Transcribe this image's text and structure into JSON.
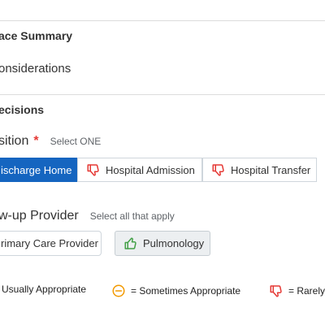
{
  "sections": {
    "summary_title": "ace Summary",
    "considerations_title": "onsiderations",
    "decisions_title": "ecisions"
  },
  "disposition": {
    "label": "sition",
    "required_marker": "*",
    "hint": "Select ONE",
    "options": [
      {
        "label": "ischarge Home",
        "state": "selected",
        "icon": "none"
      },
      {
        "label": "Hospital Admission",
        "state": "unselected",
        "icon": "thumbs-down-icon"
      },
      {
        "label": "Hospital Transfer",
        "state": "unselected",
        "icon": "thumbs-down-icon"
      }
    ]
  },
  "followup": {
    "label": "w-up Provider",
    "hint": "Select all that apply",
    "options": [
      {
        "label": "rimary Care Provider",
        "state": "unselected",
        "icon": "none"
      },
      {
        "label": "Pulmonology",
        "state": "toggled",
        "icon": "thumbs-up-icon"
      }
    ]
  },
  "legend": {
    "usually": "Usually Appropriate",
    "sometimes": "= Sometimes Appropriate",
    "rarely": "= Rarely"
  },
  "colors": {
    "primary": "#1565c0",
    "thumbs_down": "#e53935",
    "thumbs_up": "#43a047",
    "sometimes": "#f29900"
  }
}
